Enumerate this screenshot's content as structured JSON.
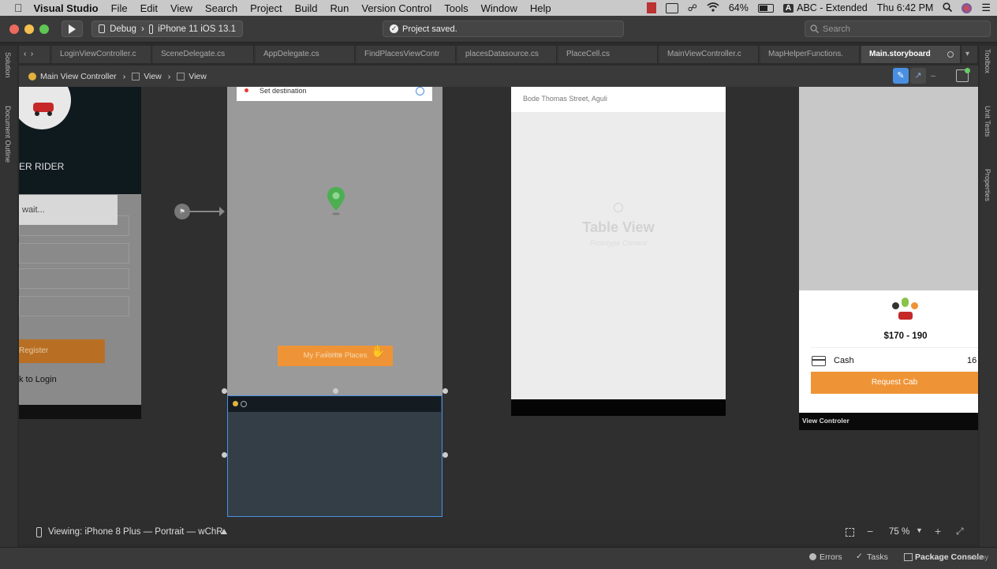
{
  "menubar": {
    "app": "Visual Studio",
    "items": [
      "File",
      "Edit",
      "View",
      "Search",
      "Project",
      "Build",
      "Run",
      "Version Control",
      "Tools",
      "Window",
      "Help"
    ],
    "battery": "64%",
    "input_source": "ABC - Extended",
    "input_badge": "A",
    "clock": "Thu 6:42 PM"
  },
  "toolbar": {
    "config": "Debug",
    "device": "iPhone 11 iOS 13.1",
    "status": "Project saved.",
    "search_placeholder": "Search"
  },
  "tabs": [
    {
      "label": "LoginViewController.c"
    },
    {
      "label": "SceneDelegate.cs"
    },
    {
      "label": "AppDelegate.cs"
    },
    {
      "label": "FindPlacesViewContr"
    },
    {
      "label": "placesDatasource.cs"
    },
    {
      "label": "PlaceCell.cs"
    },
    {
      "label": "MainViewController.c"
    },
    {
      "label": "MapHelperFunctions."
    },
    {
      "label": "Main.storyboard"
    }
  ],
  "breadcrumb": {
    "controller": "Main View Controller",
    "view1": "View",
    "view2": "View"
  },
  "side_labels": {
    "left1": "Solution",
    "left2": "Document Outline",
    "right1": "Toolbox",
    "right2": "Unit Tests",
    "right3": "Properties"
  },
  "scene1": {
    "title": "ER RIDER",
    "toast": "wait...",
    "register": "Register",
    "back_login": "k to Login"
  },
  "scene2": {
    "destination": "Set destination",
    "fav_button": "My Favorite Places",
    "overlay_text": "Done"
  },
  "scene3": {
    "address": "Bode Thomas Street, Aguli",
    "table_title": "Table View",
    "table_subtitle": "Prototype Content"
  },
  "scene4": {
    "price": "$170 - 190",
    "payment": "Cash",
    "payment_num": "16",
    "request_button": "Request Cab",
    "controller_label": "View Controler"
  },
  "bottom": {
    "viewing": "Viewing: iPhone 8 Plus — Portrait — wChR",
    "zoom": "75 %"
  },
  "statusbar": {
    "errors": "Errors",
    "tasks": "Tasks",
    "package": "Package Console",
    "watermark": "udemy"
  },
  "colors": {
    "accent_orange": "#ef9436",
    "selection_blue": "#4a90e2",
    "pin_green": "#4caf50"
  }
}
